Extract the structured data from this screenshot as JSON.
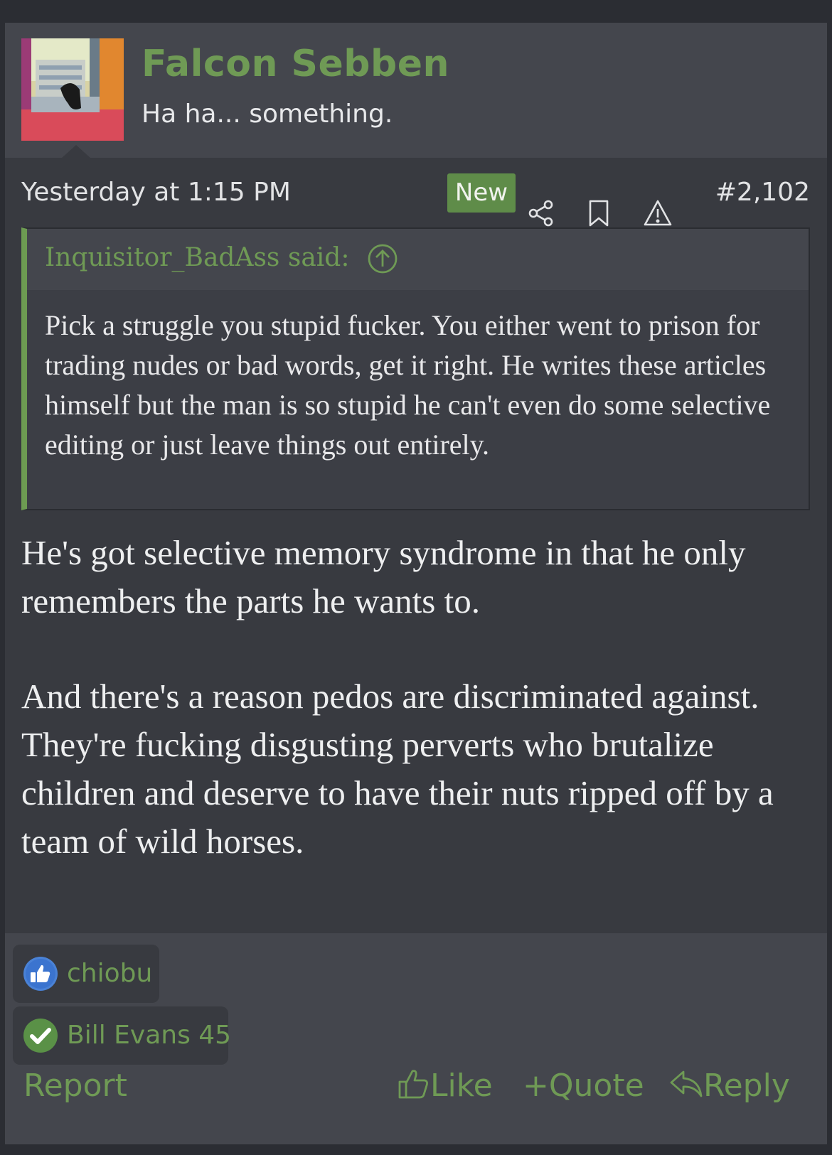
{
  "user": {
    "name": "Falcon Sebben",
    "title": "Ha ha... something."
  },
  "meta": {
    "timestamp": "Yesterday at 1:15 PM",
    "badge": "New",
    "post_number": "#2,102"
  },
  "quote": {
    "author": "Inquisitor_BadAss said:",
    "text": "Pick a struggle you stupid fucker. You either went to prison for trading nudes or bad words, get it right. He writes these articles himself but the man is so stupid he can't even do some selective editing or just leave things out entirely."
  },
  "body": {
    "paragraphs": [
      "He's got selective memory syndrome in that he only remembers the parts he wants to.",
      "And there's a reason pedos are discriminated against. They're fucking disgusting perverts who brutalize children and deserve to have their nuts ripped off by a team of wild horses."
    ]
  },
  "reactions": [
    {
      "icon": "thumbs-up-icon",
      "name": "chiobu"
    },
    {
      "icon": "checkmark-icon",
      "name": "Bill Evans 45"
    }
  ],
  "actions": {
    "report": "Report",
    "like": "Like",
    "quote": "Quote",
    "reply": "Reply"
  },
  "colors": {
    "accent_green": "#6f9a55",
    "badge_green": "#5f8c49",
    "post_bg": "#383a40",
    "header_bg": "#44464d",
    "page_bg": "#2b2d33",
    "like_blue": "#4a82d6"
  }
}
